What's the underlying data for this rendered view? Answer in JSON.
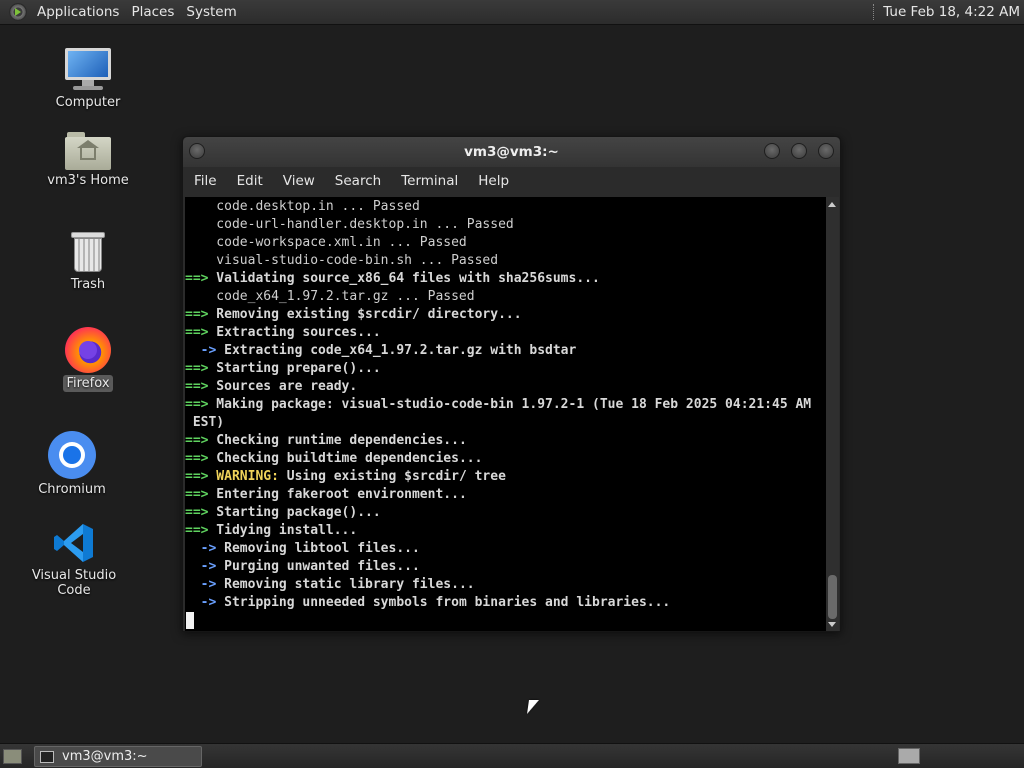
{
  "top_panel": {
    "menus": [
      "Applications",
      "Places",
      "System"
    ],
    "clock": "Tue Feb 18,  4:22 AM"
  },
  "desktop_icons": [
    {
      "label": "Computer",
      "icon": "computer-icon"
    },
    {
      "label": "vm3's Home",
      "icon": "home-folder-icon"
    },
    {
      "label": "Trash",
      "icon": "trash-icon"
    },
    {
      "label": "Firefox",
      "icon": "firefox-icon",
      "selected": true
    },
    {
      "label": "Chromium",
      "icon": "chromium-icon"
    },
    {
      "label": "Visual Studio Code",
      "icon": "vscode-icon"
    }
  ],
  "terminal": {
    "title": "vm3@vm3:~",
    "menu": [
      "File",
      "Edit",
      "View",
      "Search",
      "Terminal",
      "Help"
    ],
    "lines": [
      {
        "prefix": "",
        "kind": "plain",
        "text": "    code.desktop.in ... Passed"
      },
      {
        "prefix": "",
        "kind": "plain",
        "text": "    code-url-handler.desktop.in ... Passed"
      },
      {
        "prefix": "",
        "kind": "plain",
        "text": "    code-workspace.xml.in ... Passed"
      },
      {
        "prefix": "",
        "kind": "plain",
        "text": "    visual-studio-code-bin.sh ... Passed"
      },
      {
        "prefix": "==>",
        "kind": "main",
        "text": " Validating source_x86_64 files with sha256sums..."
      },
      {
        "prefix": "",
        "kind": "plain",
        "text": "    code_x64_1.97.2.tar.gz ... Passed"
      },
      {
        "prefix": "==>",
        "kind": "main",
        "text": " Removing existing $srcdir/ directory..."
      },
      {
        "prefix": "==>",
        "kind": "main",
        "text": " Extracting sources..."
      },
      {
        "prefix": "  ->",
        "kind": "sub",
        "text": " Extracting code_x64_1.97.2.tar.gz with bsdtar"
      },
      {
        "prefix": "==>",
        "kind": "main",
        "text": " Starting prepare()..."
      },
      {
        "prefix": "==>",
        "kind": "main",
        "text": " Sources are ready."
      },
      {
        "prefix": "==>",
        "kind": "main",
        "text": " Making package: visual-studio-code-bin 1.97.2-1 (Tue 18 Feb 2025 04:21:45 AM"
      },
      {
        "prefix": "",
        "kind": "main",
        "text": " EST)"
      },
      {
        "prefix": "==>",
        "kind": "main",
        "text": " Checking runtime dependencies..."
      },
      {
        "prefix": "==>",
        "kind": "main",
        "text": " Checking buildtime dependencies..."
      },
      {
        "prefix": "==>",
        "kind": "warn",
        "warn": " WARNING:",
        "text": " Using existing $srcdir/ tree"
      },
      {
        "prefix": "==>",
        "kind": "main",
        "text": " Entering fakeroot environment..."
      },
      {
        "prefix": "==>",
        "kind": "main",
        "text": " Starting package()..."
      },
      {
        "prefix": "==>",
        "kind": "main",
        "text": " Tidying install..."
      },
      {
        "prefix": "  ->",
        "kind": "sub",
        "text": " Removing libtool files..."
      },
      {
        "prefix": "  ->",
        "kind": "sub",
        "text": " Purging unwanted files..."
      },
      {
        "prefix": "  ->",
        "kind": "sub",
        "text": " Removing static library files..."
      },
      {
        "prefix": "  ->",
        "kind": "sub",
        "text": " Stripping unneeded symbols from binaries and libraries..."
      }
    ]
  },
  "taskbar": {
    "task_label": "vm3@vm3:~"
  }
}
